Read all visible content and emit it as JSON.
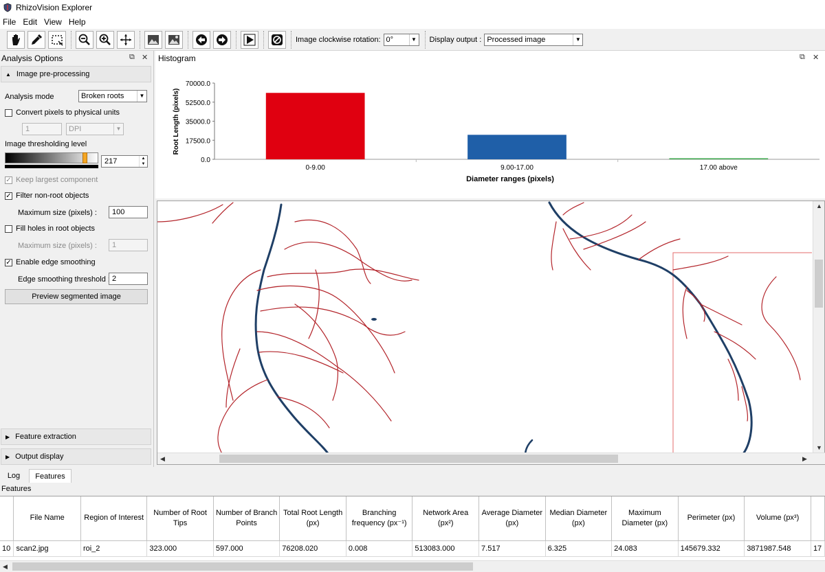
{
  "app": {
    "title": "RhizoVision Explorer"
  },
  "menu": [
    "File",
    "Edit",
    "View",
    "Help"
  ],
  "toolbar": {
    "rotation_label": "Image clockwise rotation:",
    "rotation_value": "0°",
    "display_label": "Display output :",
    "display_value": "Processed image"
  },
  "analysis_options": {
    "panel_title": "Analysis Options",
    "section_preprocessing": "Image pre-processing",
    "analysis_mode_label": "Analysis mode",
    "analysis_mode_value": "Broken roots",
    "convert_label": "Convert pixels to physical units",
    "convert_value": "1",
    "convert_unit": "DPI",
    "threshold_label": "Image thresholding level",
    "threshold_value": "217",
    "threshold_fraction": 0.851,
    "keep_largest_label": "Keep largest component",
    "filter_label": "Filter non-root objects",
    "filter_max_label": "Maximum size (pixels) :",
    "filter_max_value": "100",
    "fill_holes_label": "Fill holes in root objects",
    "fill_max_label": "Maximum size (pixels) :",
    "fill_max_value": "1",
    "edge_smoothing_label": "Enable edge smoothing",
    "edge_threshold_label": "Edge smoothing threshold :",
    "edge_threshold_value": "2",
    "preview_button": "Preview segmented image",
    "section_feature": "Feature extraction",
    "section_output": "Output display"
  },
  "histogram": {
    "panel_title": "Histogram"
  },
  "chart_data": {
    "type": "bar",
    "title": "",
    "xlabel": "Diameter ranges (pixels)",
    "ylabel": "Root Length (pixels)",
    "categories": [
      "0-9.00",
      "9.00-17.00",
      "17.00 above"
    ],
    "values": [
      61000,
      22500,
      500
    ],
    "colors": [
      "#e00010",
      "#1f5fa8",
      "#3aa64a"
    ],
    "yticks": [
      "70000.0",
      "52500.0",
      "35000.0",
      "17500.0",
      "0.0"
    ],
    "ylim": [
      0,
      70000
    ]
  },
  "tabs": [
    "Log",
    "Features"
  ],
  "features": {
    "label": "Features",
    "columns": [
      "",
      "File Name",
      "Region of Interest",
      "Number of Root Tips",
      "Number of Branch Points",
      "Total Root Length (px)",
      "Branching frequency (px⁻¹)",
      "Network Area (px²)",
      "Average Diameter (px)",
      "Median Diameter (px)",
      "Maximum Diameter (px)",
      "Perimeter (px)",
      "Volume (px³)",
      ""
    ],
    "rows": [
      [
        "10",
        "scan2.jpg",
        "roi_2",
        "323.000",
        "597.000",
        "76208.020",
        "0.008",
        "513083.000",
        "7.517",
        "6.325",
        "24.083",
        "145679.332",
        "3871987.548",
        "17"
      ]
    ]
  }
}
